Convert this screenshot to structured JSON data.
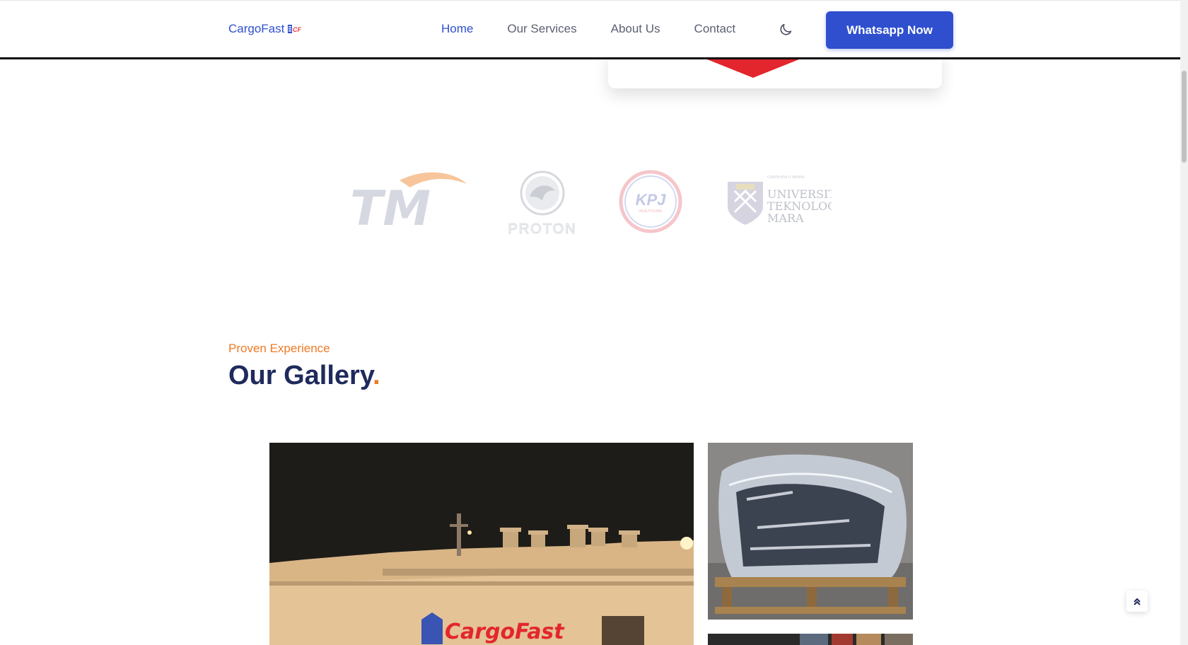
{
  "navbar": {
    "brand": "CargoFast",
    "links": [
      {
        "label": "Home",
        "active": true
      },
      {
        "label": "Our Services",
        "active": false
      },
      {
        "label": "About Us",
        "active": false
      },
      {
        "label": "Contact",
        "active": false
      }
    ],
    "theme_icon": "moon-icon",
    "cta_label": "Whatsapp Now"
  },
  "clients": [
    {
      "name": "TM",
      "logo_text": "TM"
    },
    {
      "name": "Proton",
      "logo_text": "PROTON"
    },
    {
      "name": "KPJ Healthcare",
      "logo_text": "KPJ"
    },
    {
      "name": "Universiti Teknologi Mara",
      "logo_text": "UNIVERSITI TEKNOLOGI MARA"
    }
  ],
  "gallery": {
    "eyebrow": "Proven Experience",
    "title": "Our Gallery",
    "title_dot": ".",
    "main_image_caption": "CargoFast"
  },
  "scroll_top_icon": "double-chevron-up-icon",
  "colors": {
    "brand": "#2f4fcf",
    "accent": "#f07a24",
    "heading": "#1f2a5c",
    "nav_text": "#5b6172"
  }
}
